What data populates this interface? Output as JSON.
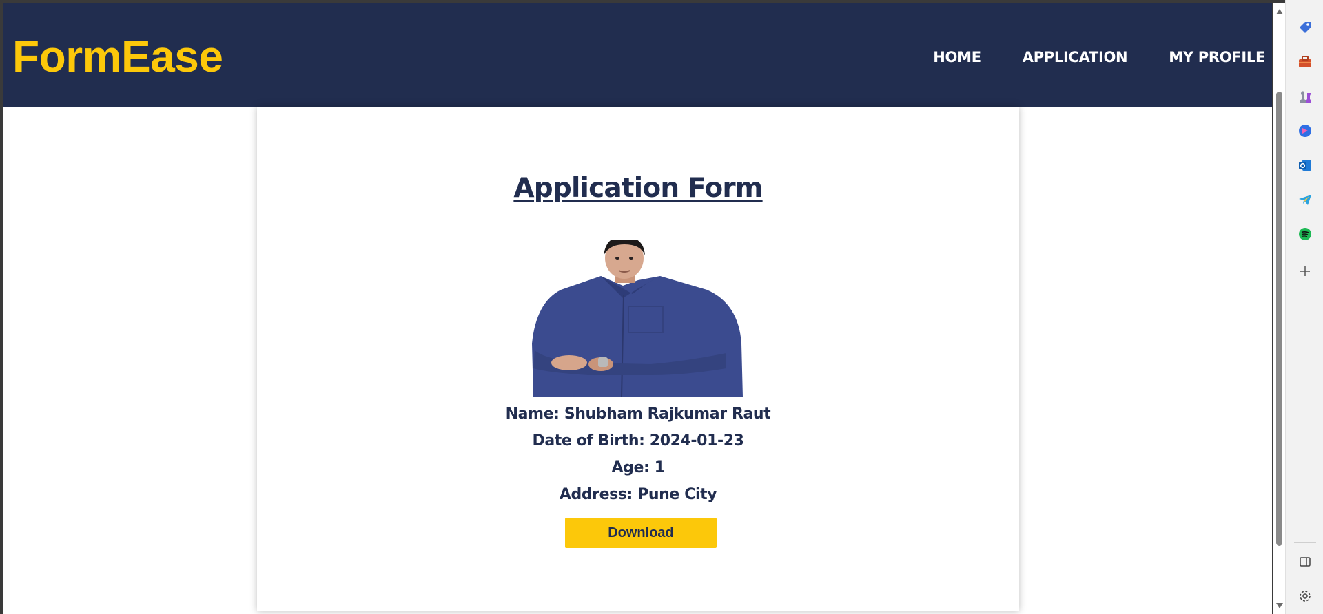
{
  "navbar": {
    "logo": "FormEase",
    "links": [
      "HOME",
      "APPLICATION",
      "MY PROFILE"
    ]
  },
  "form": {
    "title": "Application Form",
    "name_line": "Name: Shubham Rajkumar Raut",
    "dob_line": "Date of Birth: 2024-01-23",
    "age_line": "Age: 1",
    "address_line": "Address: Pune City",
    "download_label": "Download"
  },
  "browser_sidebar": {
    "icons": [
      "tag-icon",
      "toolbox-icon",
      "chess-icon",
      "copilot-icon",
      "outlook-icon",
      "telegram-icon",
      "spotify-icon",
      "add-icon",
      "split-view-icon",
      "settings-icon"
    ]
  },
  "colors": {
    "navbar_bg": "#212d4f",
    "accent": "#fcc80a",
    "text": "#212d4f"
  }
}
